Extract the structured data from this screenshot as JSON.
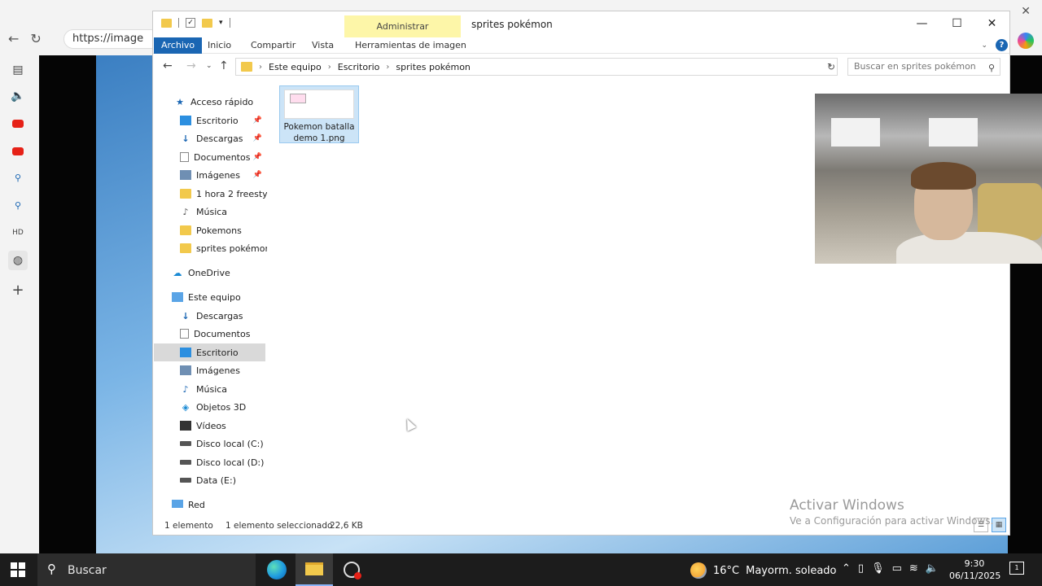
{
  "browser": {
    "url_text": "https://image",
    "close_glyph": "✕"
  },
  "explorer": {
    "title": "sprites pokémon",
    "context_tab": "Administrar",
    "ribbon_tabs": [
      "Archivo",
      "Inicio",
      "Compartir",
      "Vista",
      "Herramientas de imagen"
    ],
    "breadcrumb": [
      "Este equipo",
      "Escritorio",
      "sprites pokémon"
    ],
    "search_placeholder": "Buscar en sprites pokémon",
    "nav": {
      "quick_access": "Acceso rápido",
      "quick_items": [
        {
          "label": "Escritorio",
          "icon": "desktop-icon",
          "pinned": true
        },
        {
          "label": "Descargas",
          "icon": "download-icon",
          "pinned": true
        },
        {
          "label": "Documentos",
          "icon": "document-icon",
          "pinned": true
        },
        {
          "label": "Imágenes",
          "icon": "pictures-icon",
          "pinned": true
        },
        {
          "label": "1 hora 2 freestyles",
          "icon": "folder-icon",
          "pinned": false
        },
        {
          "label": "Música",
          "icon": "music-icon",
          "pinned": false
        },
        {
          "label": "Pokemons",
          "icon": "folder-icon",
          "pinned": false
        },
        {
          "label": "sprites pokémon",
          "icon": "folder-icon",
          "pinned": false
        }
      ],
      "onedrive": "OneDrive",
      "this_pc": "Este equipo",
      "pc_items": [
        {
          "label": "Descargas",
          "icon": "download-icon"
        },
        {
          "label": "Documentos",
          "icon": "document-icon"
        },
        {
          "label": "Escritorio",
          "icon": "desktop-icon",
          "selected": true
        },
        {
          "label": "Imágenes",
          "icon": "pictures-icon"
        },
        {
          "label": "Música",
          "icon": "music-icon"
        },
        {
          "label": "Objetos 3D",
          "icon": "cube-icon"
        },
        {
          "label": "Vídeos",
          "icon": "video-icon"
        },
        {
          "label": "Disco local (C:)",
          "icon": "drive-icon"
        },
        {
          "label": "Disco local (D:)",
          "icon": "drive-icon"
        },
        {
          "label": "Data (E:)",
          "icon": "drive-icon"
        }
      ],
      "network": "Red"
    },
    "files": [
      {
        "name_line1": "Pokemon batalla",
        "name_line2": "demo 1.png",
        "selected": true
      }
    ],
    "status": {
      "count": "1 elemento",
      "selection": "1 elemento seleccionado",
      "size": "22,6 KB"
    }
  },
  "watermark": {
    "title": "Activar Windows",
    "subtitle": "Ve a Configuración para activar Windows."
  },
  "taskbar": {
    "search_label": "Buscar",
    "weather_temp": "16°C",
    "weather_desc": "Mayorm. soleado",
    "time": "9:30",
    "date": "06/11/2025",
    "notification_count": "1"
  }
}
